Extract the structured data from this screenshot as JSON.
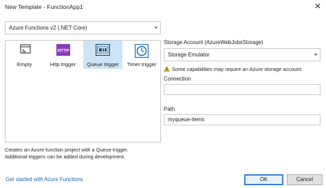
{
  "window": {
    "title": "New Template - FunctionApp1"
  },
  "framework": {
    "selected": "Azure Functions v2 (.NET Core)"
  },
  "triggers": [
    {
      "label": "Empty",
      "icon": "empty-icon",
      "selected": false
    },
    {
      "label": "Http trigger",
      "icon": "http-icon",
      "icon_text": "HTTP",
      "selected": false
    },
    {
      "label": "Queue trigger",
      "icon": "queue-icon",
      "selected": true
    },
    {
      "label": "Timer trigger",
      "icon": "timer-icon",
      "selected": false
    }
  ],
  "description": {
    "line1": "Creates an Azure function project with a Queue trigger.",
    "line2": "Additional triggers can be added during development."
  },
  "storage": {
    "label": "Storage Account (AzureWebJobsStorage)",
    "value": "Storage Emulator",
    "warning": "Some capabilities may require an Azure storage account."
  },
  "connection": {
    "label": "Connection",
    "value": ""
  },
  "path": {
    "label": "Path",
    "value": "myqueue-items"
  },
  "footer": {
    "link": "Get started with Azure Functions",
    "ok": "OK",
    "cancel": "Cancel"
  },
  "colors": {
    "accent": "#3c7fd6",
    "selection": "#cce4f7",
    "link": "#1a66b3",
    "http_icon": "#8a3ab9",
    "warning": "#e8b400"
  }
}
